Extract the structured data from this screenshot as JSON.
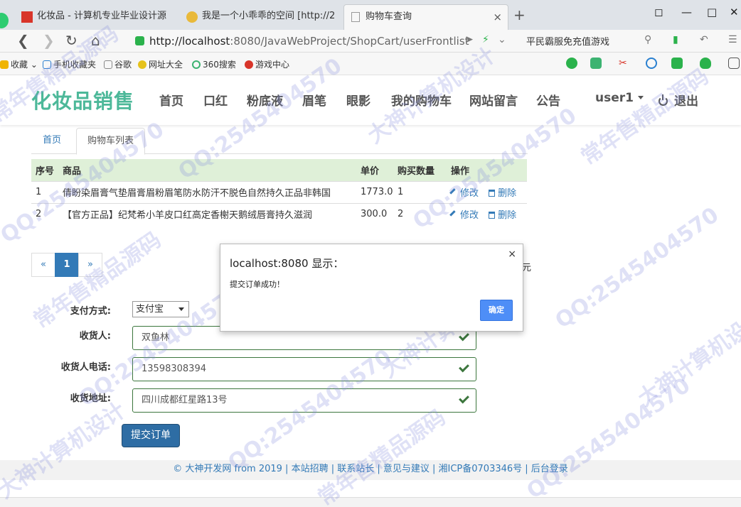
{
  "browser": {
    "tabs": [
      {
        "label": "化妆品 - 计算机专业毕业设计源",
        "favicon_color": "#d8352a"
      },
      {
        "label": "我是一个小乖乖的空间 [http://2",
        "favicon_color": "#e9b93a"
      },
      {
        "label": "购物车查询",
        "close": "×",
        "favicon_color": "#cccccc"
      }
    ],
    "new_tab": "+",
    "url_host": "http://localhost",
    "url_path": ":8080/JavaWebProject/ShopCart/userFrontlist",
    "search_placeholder": "平民霸服免充值游戏",
    "bookmarks": [
      "收藏",
      "手机收藏夹",
      "谷歌",
      "网址大全",
      "360搜索",
      "游戏中心"
    ]
  },
  "site": {
    "brand": "化妆品销售",
    "nav": [
      "首页",
      "口红",
      "粉底液",
      "眉笔",
      "眼影",
      "我的购物车",
      "网站留言",
      "公告"
    ],
    "user": "user1",
    "logout": "退出"
  },
  "crumbs": {
    "home": "首页",
    "current": "购物车列表"
  },
  "table": {
    "headers": [
      "序号",
      "商品",
      "单价",
      "购买数量",
      "操作"
    ],
    "rows": [
      {
        "no": "1",
        "product": "倩盼染眉膏气垫眉膏眉粉眉笔防水防汗不脱色自然持久正品非韩国",
        "price": "1773.0",
        "qty": "1"
      },
      {
        "no": "2",
        "product": "【官方正品】纪梵希小羊皮口红高定香榭天鹅绒唇膏持久滋润",
        "price": "300.0",
        "qty": "2"
      }
    ],
    "edit_label": "修改",
    "delete_label": "删除"
  },
  "pager": {
    "prev": "«",
    "current": "1",
    "next": "»",
    "trailing": "元"
  },
  "form": {
    "pay_label": "支付方式:",
    "pay_value": "支付宝",
    "receiver_label": "收货人:",
    "receiver_value": "双鱼林",
    "phone_label": "收货人电话:",
    "phone_value": "13598308394",
    "address_label": "收货地址:",
    "address_value": "四川成都红星路13号",
    "submit": "提交订单"
  },
  "footer": "© 大神开发网 from 2019 | 本站招聘 | 联系站长 | 意见与建议 | 湘ICP备0703346号 | 后台登录",
  "dialog": {
    "title": "localhost:8080 显示：",
    "message": "提交订单成功！",
    "ok": "确定",
    "close": "×"
  },
  "watermark": [
    "QQ:2545404570",
    "常年售精品源码",
    "大神计算机设计"
  ],
  "colors": {
    "brand": "#4cb899",
    "link": "#337ab7",
    "table_head": "#dff0d8",
    "primary_btn": "#2e6da4",
    "success": "#3c763d"
  }
}
